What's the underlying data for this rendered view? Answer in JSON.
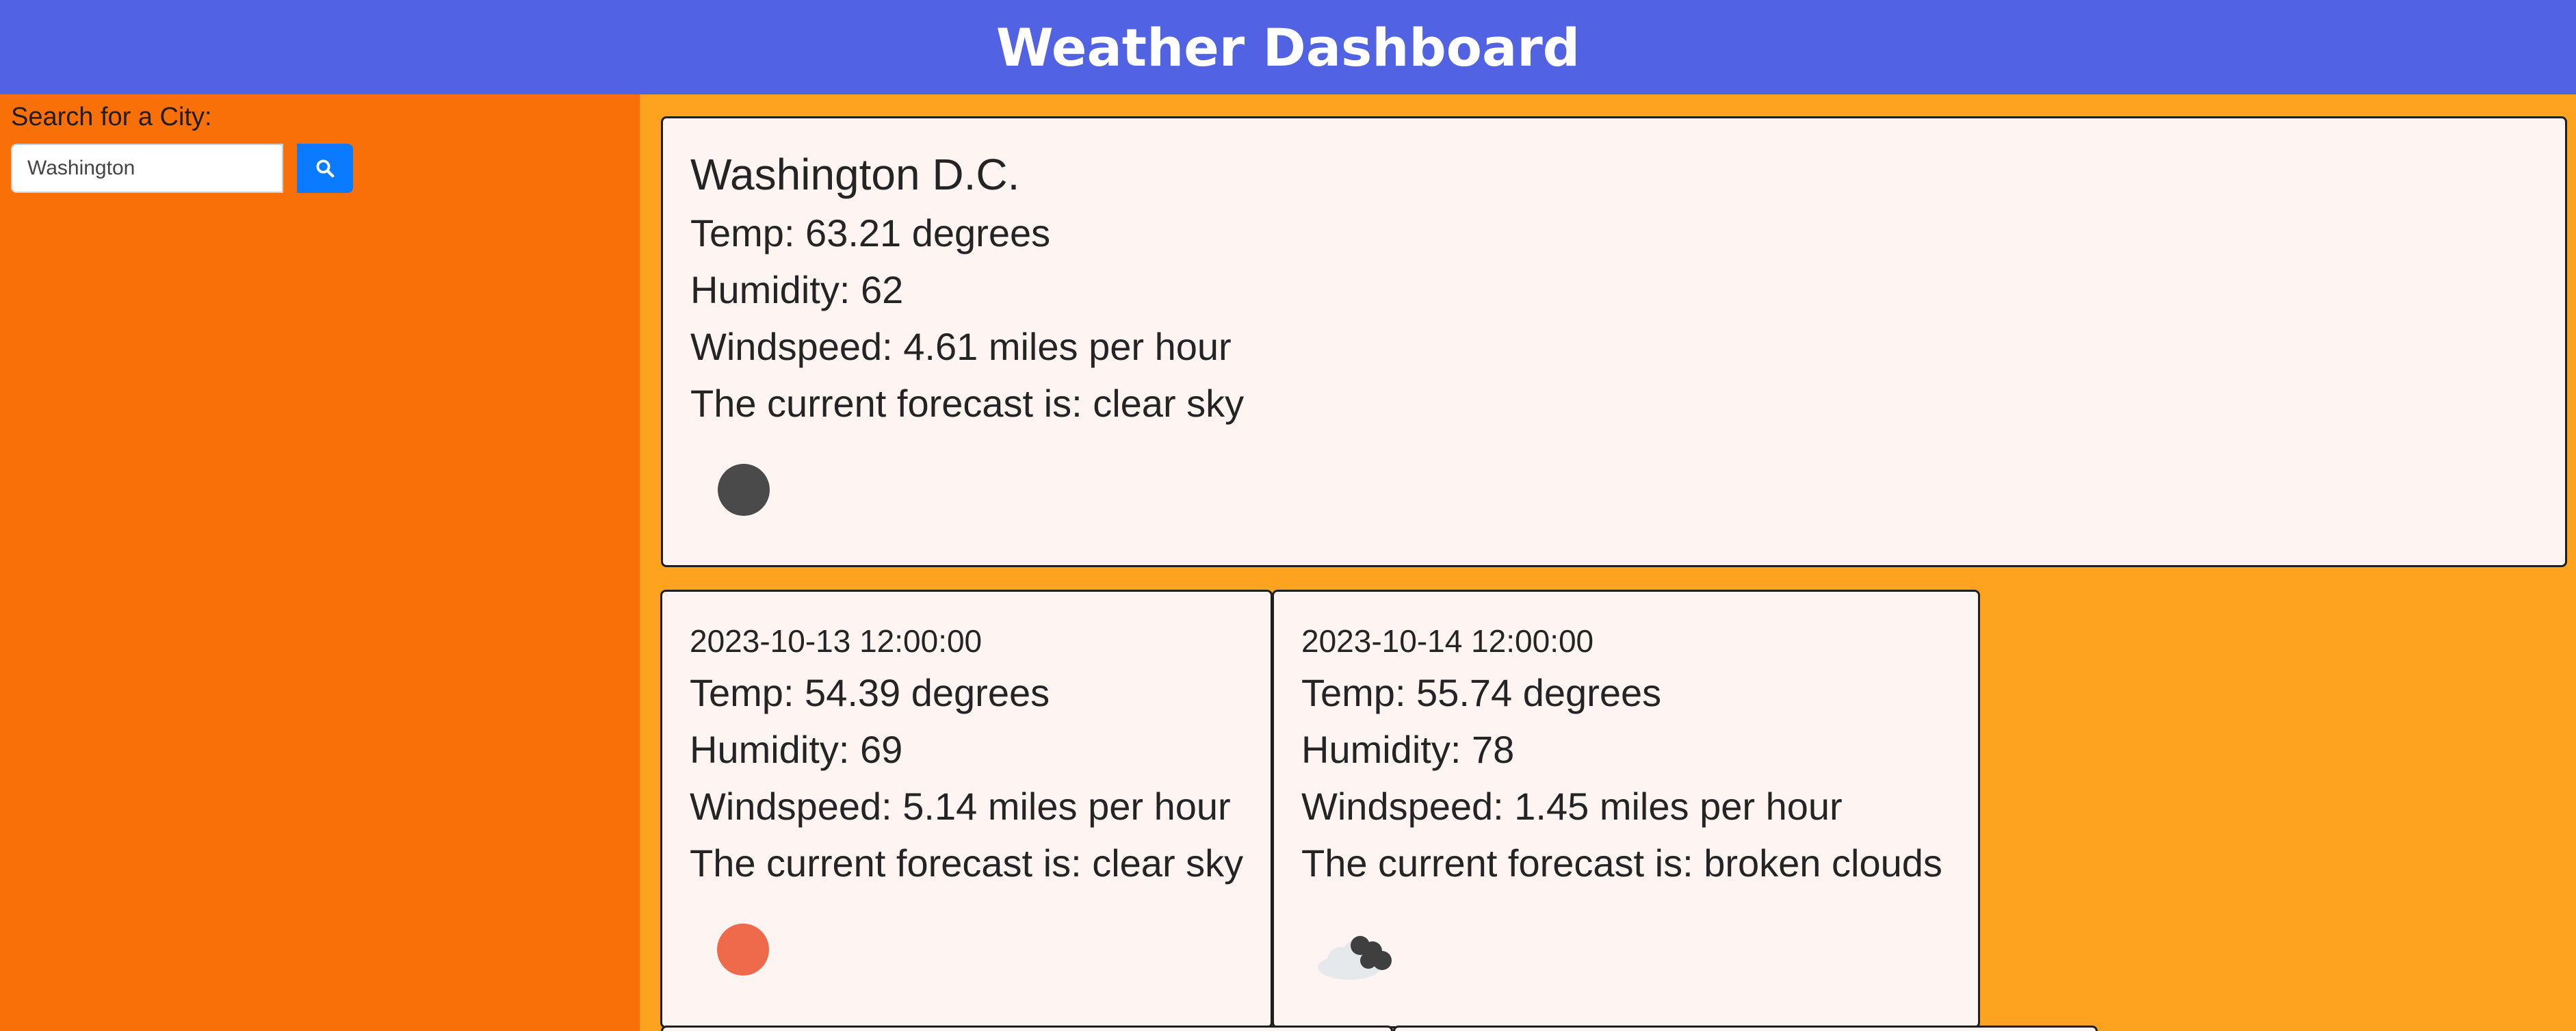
{
  "header": {
    "title": "Weather Dashboard"
  },
  "search": {
    "label": "Search for a City:",
    "value": "Washington",
    "button_icon": "search-icon"
  },
  "current": {
    "city": "Washington D.C.",
    "temp": "Temp: 63.21 degrees",
    "humidity": "Humidity: 62",
    "windspeed": "Windspeed: 4.61 miles per hour",
    "forecast": "The current forecast is: clear sky",
    "icon": "clear-sky-night-icon"
  },
  "forecast": [
    {
      "date": "2023-10-13 12:00:00",
      "temp": "Temp: 54.39 degrees",
      "humidity": "Humidity: 69",
      "windspeed": "Windspeed: 5.14 miles per hour",
      "forecast": "The current forecast is: clear sky",
      "icon": "clear-sky-icon"
    },
    {
      "date": "2023-10-14 12:00:00",
      "temp": "Temp: 55.74 degrees",
      "humidity": "Humidity: 78",
      "windspeed": "Windspeed: 1.45 miles per hour",
      "forecast": "The current forecast is: broken clouds",
      "icon": "broken-clouds-icon"
    }
  ],
  "colors": {
    "header": "#5162e3",
    "sidebar": "#f97008",
    "main": "#fea31f",
    "card": "#fef4f2",
    "accent": "#0a7bff"
  }
}
